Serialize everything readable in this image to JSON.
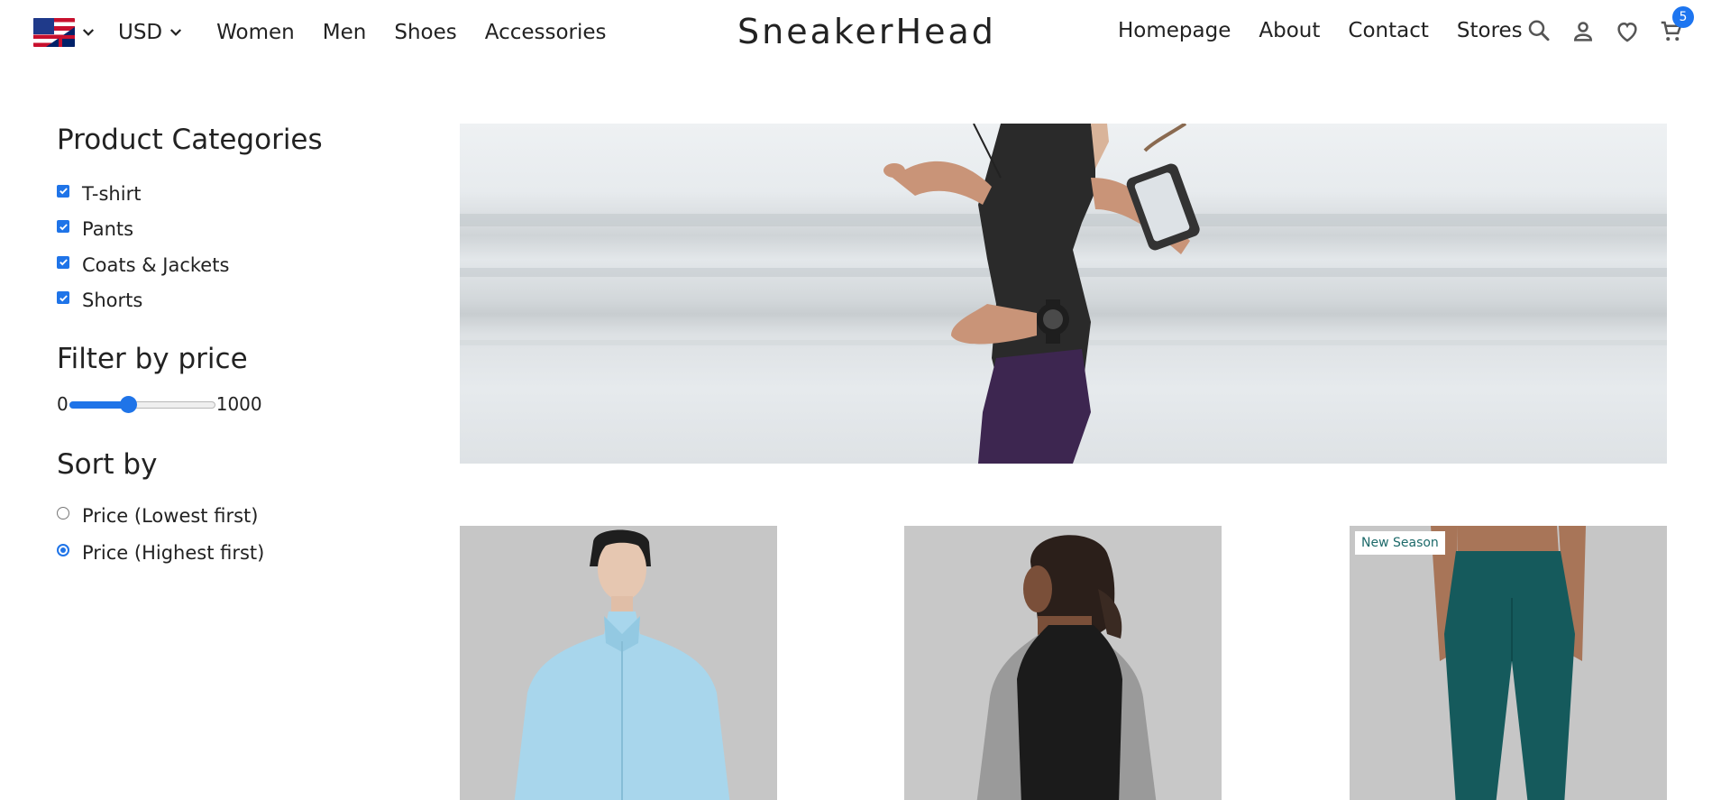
{
  "header": {
    "language_icon": "us-uk-flag-icon",
    "currency": "USD",
    "left_links": [
      "Women",
      "Men",
      "Shoes",
      "Accessories"
    ],
    "brand": "SneakerHead",
    "right_links": [
      "Homepage",
      "About",
      "Contact",
      "Stores"
    ],
    "icons": [
      "search-icon",
      "account-icon",
      "heart-icon",
      "cart-icon"
    ],
    "cart_count": "5"
  },
  "sidebar": {
    "categories_title": "Product Categories",
    "categories": [
      {
        "label": "T-shirt",
        "checked": true
      },
      {
        "label": "Pants",
        "checked": true
      },
      {
        "label": "Coats & Jackets",
        "checked": true
      },
      {
        "label": "Shorts",
        "checked": true
      }
    ],
    "price_title": "Filter by price",
    "price_min": "0",
    "price_max": "1000",
    "price_value_fraction": 0.4,
    "sort_title": "Sort by",
    "sort_options": [
      {
        "label": "Price (Lowest first)",
        "selected": false
      },
      {
        "label": "Price (Highest first)",
        "selected": true
      }
    ]
  },
  "products": [
    {
      "image": "woman-light-blue-jacket",
      "tag": ""
    },
    {
      "image": "woman-black-vest-back",
      "tag": ""
    },
    {
      "image": "teal-leggings",
      "tag": "New Season"
    }
  ],
  "colors": {
    "accent": "#1f74e8",
    "badge": "#1d75f0",
    "tag_text": "#1d6a6a"
  }
}
